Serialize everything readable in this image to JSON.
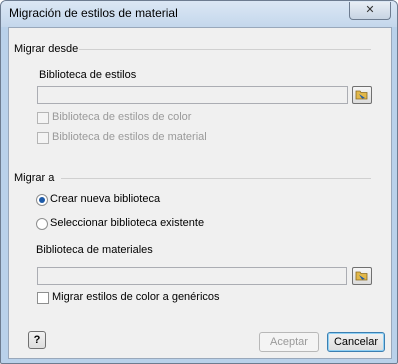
{
  "window": {
    "title": "Migración de estilos de material",
    "close_glyph": "✕"
  },
  "migrate_from": {
    "section_label": "Migrar desde",
    "library_label": "Biblioteca de estilos",
    "library_value": "",
    "color_styles_label": "Biblioteca de estilos de color",
    "material_styles_label": "Biblioteca de estilos de material"
  },
  "migrate_to": {
    "section_label": "Migrar a",
    "create_new_label": "Crear nueva biblioteca",
    "select_existing_label": "Seleccionar biblioteca existente",
    "selected_option": "create_new",
    "materials_library_label": "Biblioteca de materiales",
    "materials_library_value": "",
    "generic_colors_label": "Migrar estilos de color a genéricos"
  },
  "buttons": {
    "help_glyph": "?",
    "accept_label": "Aceptar",
    "cancel_label": "Cancelar"
  },
  "icons": {
    "browse": "folder-arrow-icon",
    "help": "help-icon"
  }
}
